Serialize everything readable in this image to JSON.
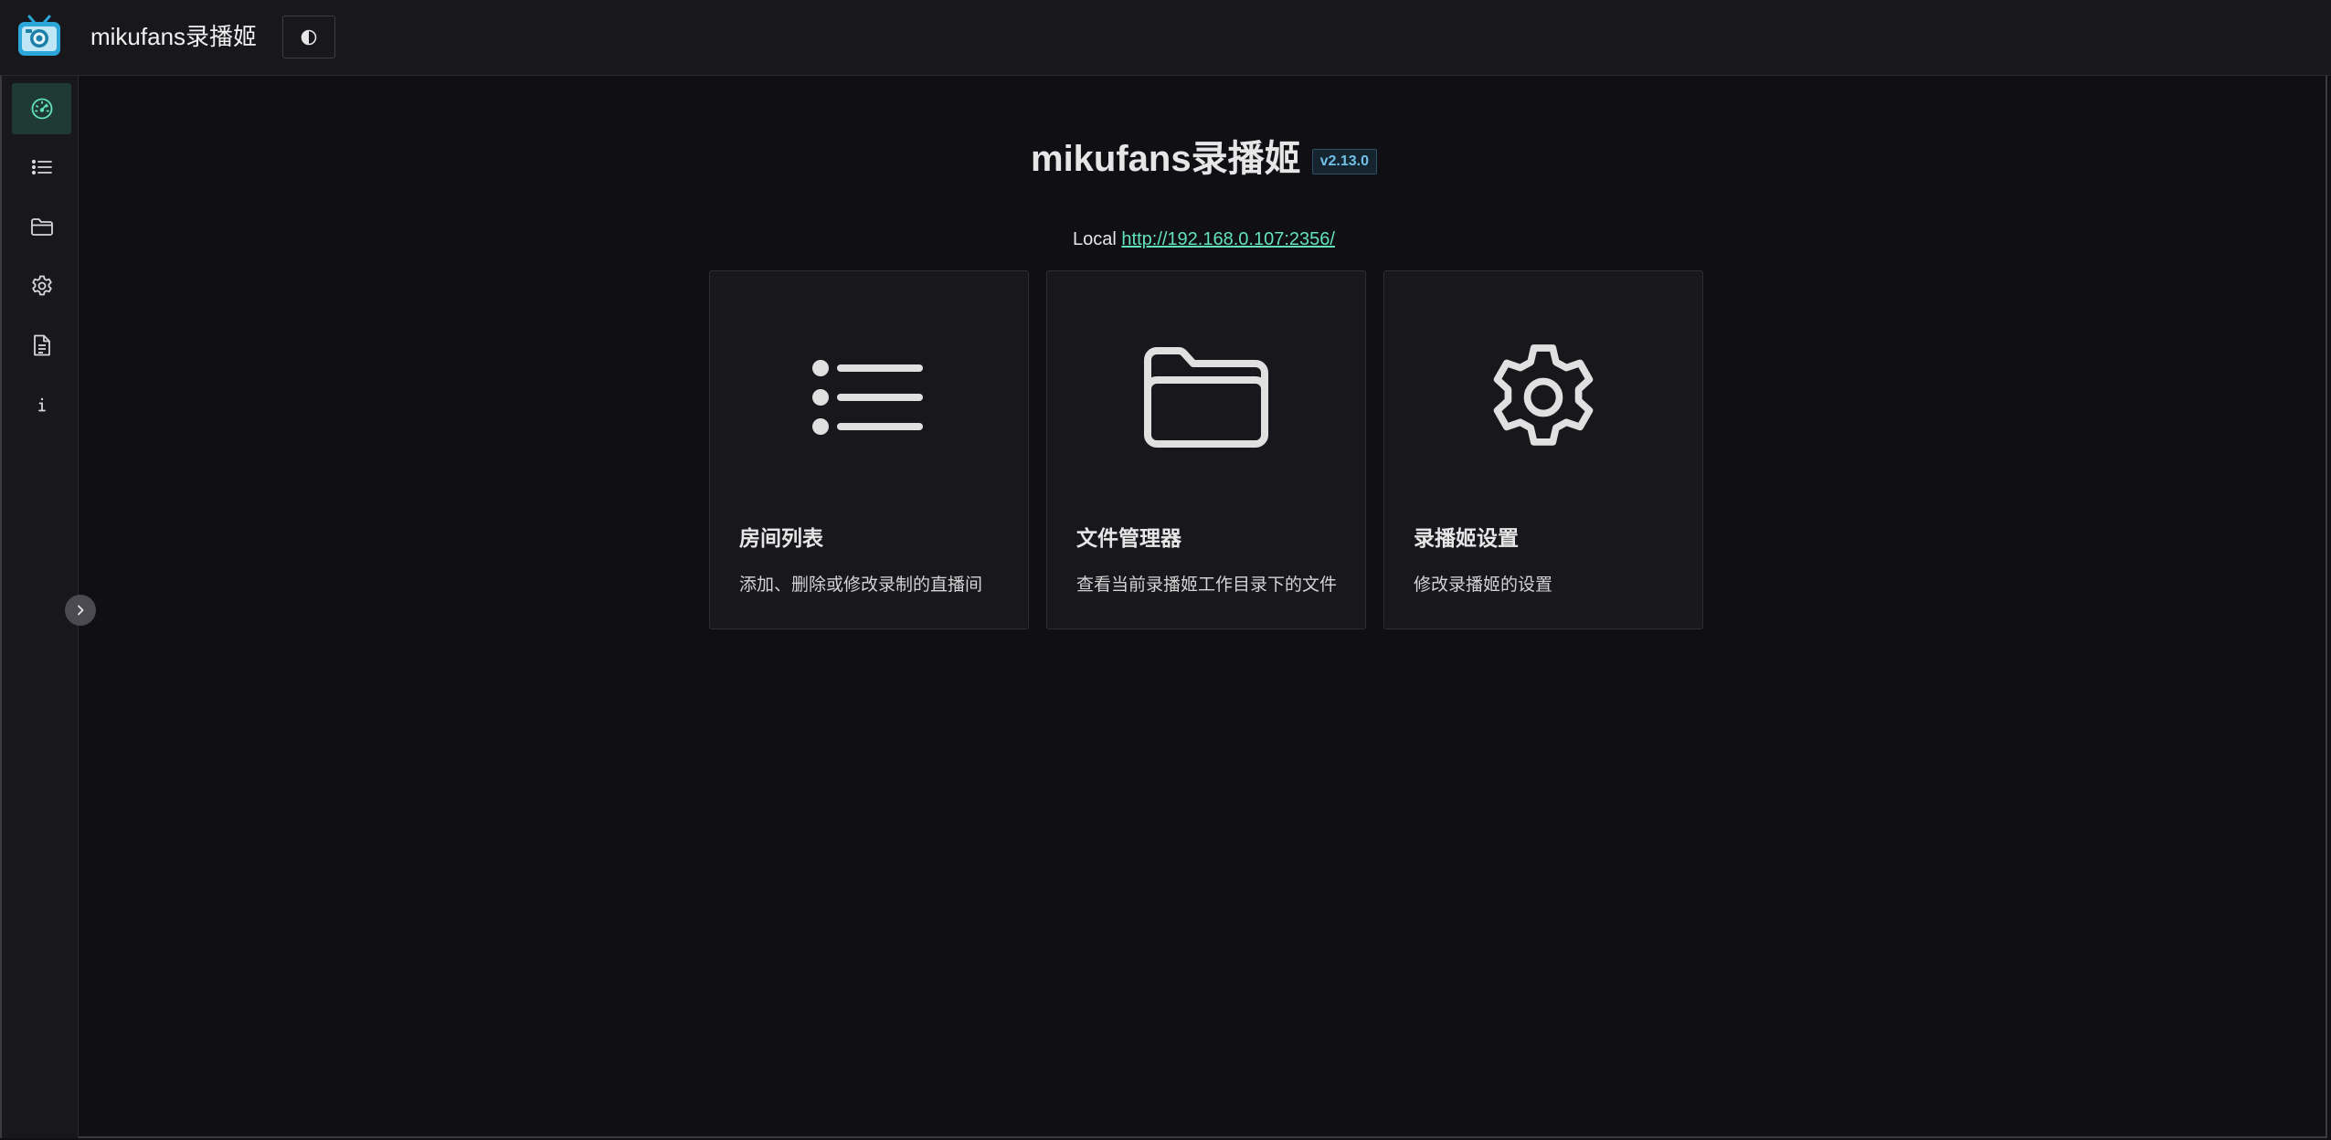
{
  "header": {
    "app_title": "mikufans录播姬",
    "logo_icon": "tv-camera-logo-icon",
    "theme_toggle_icon": "half-circle-contrast-icon"
  },
  "sidebar": {
    "items": [
      {
        "name": "dashboard",
        "icon": "speedometer-icon",
        "active": true
      },
      {
        "name": "room-list",
        "icon": "list-icon",
        "active": false
      },
      {
        "name": "file-manager",
        "icon": "folder-icon",
        "active": false
      },
      {
        "name": "settings",
        "icon": "gear-icon",
        "active": false
      },
      {
        "name": "logs",
        "icon": "document-icon",
        "active": false
      },
      {
        "name": "about",
        "icon": "info-icon",
        "active": false
      }
    ],
    "collapse_icon": "chevron-right-icon"
  },
  "main": {
    "title": "mikufans录播姬",
    "version": "v2.13.0",
    "local_label": "Local",
    "local_url": "http://192.168.0.107:2356/",
    "cards": [
      {
        "icon": "list-icon",
        "title": "房间列表",
        "description": "添加、删除或修改录制的直播间"
      },
      {
        "icon": "folder-icon",
        "title": "文件管理器",
        "description": "查看当前录播姬工作目录下的文件"
      },
      {
        "icon": "gear-icon",
        "title": "录播姬设置",
        "description": "修改录播姬的设置"
      }
    ]
  },
  "colors": {
    "background": "#101014",
    "surface": "#18181c",
    "accent": "#63e2b7",
    "badge_text": "#70c0e8"
  }
}
